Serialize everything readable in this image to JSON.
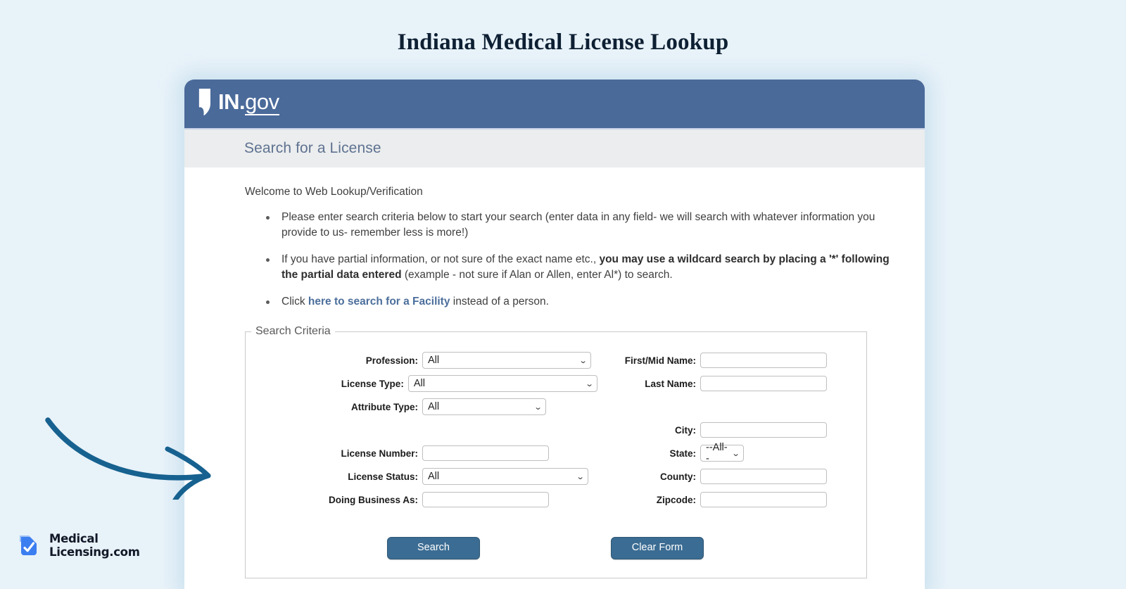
{
  "page": {
    "title": "Indiana Medical License Lookup",
    "background_color": "#e8f2f9"
  },
  "gov_header": {
    "logo_in": "IN",
    "logo_dot": ".",
    "logo_gov": "gov",
    "icon": "indiana-state-shape-icon",
    "background_color": "#4a6a9a"
  },
  "subbar": {
    "title": "Search for a License",
    "background_color": "#ebedee",
    "text_color": "#5f7291"
  },
  "content": {
    "welcome": "Welcome to Web Lookup/Verification",
    "notes": [
      {
        "id": "note-search-criteria",
        "parts": [
          {
            "text": "Please enter search criteria below to start your search (enter data in any field- we will search with whatever information you provide to us- remember less is more!)",
            "style": "normal"
          }
        ]
      },
      {
        "id": "note-wildcard",
        "parts": [
          {
            "text": "If you have partial information, or not sure of the exact name etc., ",
            "style": "normal"
          },
          {
            "text": "you may use a wildcard search by placing a '*' following the partial data entered",
            "style": "bold"
          },
          {
            "text": " (example - not sure if Alan or Allen, enter Al*) to search.",
            "style": "normal"
          }
        ]
      },
      {
        "id": "note-facility",
        "parts": [
          {
            "text": "Click ",
            "style": "normal"
          },
          {
            "text": "here to search for a Facility",
            "style": "link"
          },
          {
            "text": " instead of a person.",
            "style": "normal"
          }
        ]
      }
    ]
  },
  "search_criteria": {
    "legend": "Search Criteria",
    "left_fields": [
      {
        "label": "Profession:",
        "type": "select",
        "value": "All",
        "width_class": "w-prof"
      },
      {
        "label": "License Type:",
        "type": "select",
        "value": "All",
        "width_class": "w-lic"
      },
      {
        "label": "Attribute Type:",
        "type": "select",
        "value": "All",
        "width_class": "w-attr"
      },
      {
        "label": "License Number:",
        "type": "text",
        "value": "",
        "width_class": "w-num"
      },
      {
        "label": "License Status:",
        "type": "select",
        "value": "All",
        "width_class": "w-stat"
      },
      {
        "label": "Doing Business As:",
        "type": "text",
        "value": "",
        "width_class": "w-dba"
      }
    ],
    "right_fields": [
      {
        "label": "First/Mid Name:",
        "type": "text",
        "value": "",
        "width_class": "w-name"
      },
      {
        "label": "Last Name:",
        "type": "text",
        "value": "",
        "width_class": "w-name"
      },
      {
        "label": "City:",
        "type": "text",
        "value": "",
        "width_class": "w-city"
      },
      {
        "label": "State:",
        "type": "select",
        "value": "--All--",
        "width_class": "w-state"
      },
      {
        "label": "County:",
        "type": "text",
        "value": "",
        "width_class": "w-cnty"
      },
      {
        "label": "Zipcode:",
        "type": "text",
        "value": "",
        "width_class": "w-zip"
      }
    ],
    "chevron_glyph": "⌄",
    "buttons": {
      "search": "Search",
      "clear": "Clear Form",
      "color": "#3b6c93"
    }
  },
  "annotation": {
    "arrow_icon": "curved-arrow-right-icon",
    "arrow_color": "#16618f"
  },
  "brand": {
    "icon": "medical-licensing-check-logo-icon",
    "line1": "Medical",
    "line2": "Licensing.com",
    "color": "#3b7ef0"
  }
}
